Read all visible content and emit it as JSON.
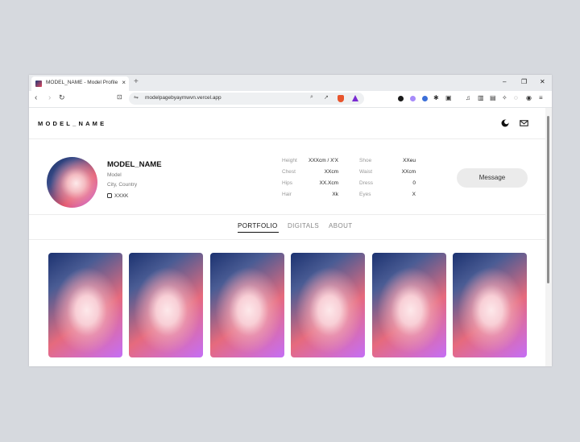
{
  "browser": {
    "tab_title": "MODEL_NAME - Model Profile",
    "tab_close": "×",
    "new_tab": "+",
    "url": "modelpagebyaymwvn.vercel.app",
    "controls": {
      "minimize": "–",
      "restore": "❐",
      "close": "✕"
    }
  },
  "site": {
    "logo": "MODEL_NAME",
    "profile": {
      "name": "MODEL_NAME",
      "role": "Model",
      "location": "City, Country",
      "instagram": "XXXK"
    },
    "stats": [
      {
        "label": "Height",
        "value": "XXXcm / X'X"
      },
      {
        "label": "Chest",
        "value": "XXcm"
      },
      {
        "label": "Hips",
        "value": "XX.Xcm"
      },
      {
        "label": "Hair",
        "value": "Xk"
      },
      {
        "label": "Shoe",
        "value": "XXeu"
      },
      {
        "label": "Waist",
        "value": "XXcm"
      },
      {
        "label": "Dress",
        "value": "0"
      },
      {
        "label": "Eyes",
        "value": "X"
      }
    ],
    "message_button": "Message",
    "tabs": [
      "PORTFOLIO",
      "DIGITALS",
      "ABOUT"
    ],
    "active_tab": "PORTFOLIO"
  },
  "colors": {
    "gradient_dark": "#1c3270",
    "gradient_red": "#e66a7d",
    "gradient_purple": "#c56ef5",
    "gradient_light": "#fde8ea"
  }
}
